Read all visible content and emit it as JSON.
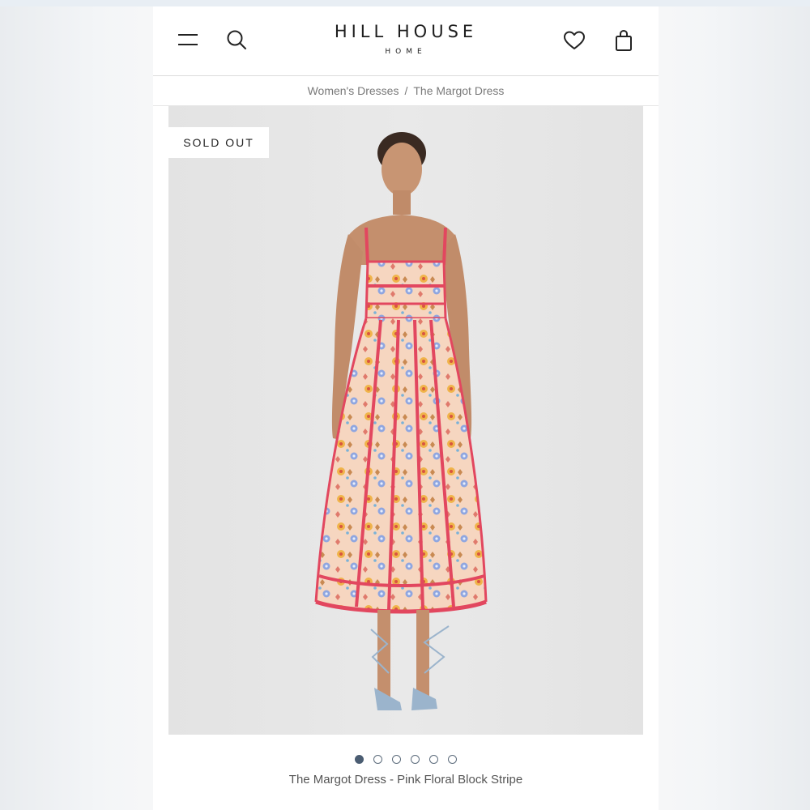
{
  "brand": {
    "name": "HILL HOUSE",
    "subname": "HOME"
  },
  "header": {
    "icons": [
      "menu-icon",
      "search-icon",
      "heart-icon",
      "shopping-bag-icon"
    ]
  },
  "breadcrumb": {
    "items": [
      "Women's Dresses",
      "The Margot Dress"
    ],
    "separator": "/"
  },
  "product": {
    "badge": "SOLD OUT",
    "caption": "The Margot Dress - Pink Floral Block Stripe",
    "image_count": 6,
    "active_image": 1
  },
  "colors": {
    "accent_dot": "#4b5d72",
    "dress_stripe": "#e2475f",
    "dress_base": "#f7d9c4",
    "background": "#e6e6e6"
  }
}
